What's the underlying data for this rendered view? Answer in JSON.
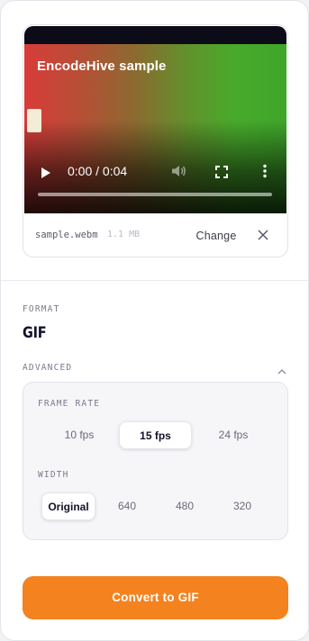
{
  "preview": {
    "title": "EncodeHive sample",
    "time": "0:00 / 0:04",
    "progress_fraction": 0,
    "controls": [
      "play-icon",
      "volume-icon",
      "fullscreen-icon",
      "more-icon"
    ]
  },
  "file": {
    "name": "sample.webm",
    "size": "1.1 MB",
    "change_label": "Change",
    "close_icon": "close-icon"
  },
  "format": {
    "label": "FORMAT",
    "value": "GIF"
  },
  "advanced": {
    "label": "ADVANCED",
    "icon": "chevron-up-icon",
    "frame_rate": {
      "label": "FRAME RATE",
      "options": [
        "10 fps",
        "15 fps",
        "24 fps"
      ],
      "selected": "15 fps"
    },
    "width": {
      "label": "WIDTH",
      "options": [
        "Original",
        "640",
        "480",
        "320"
      ],
      "selected": "Original"
    }
  },
  "convert": {
    "label": "Convert to GIF",
    "color": "#f4821f"
  },
  "colors": {
    "accent": "#f4821f",
    "text_dark": "#12122a",
    "panel_bg": "#f6f6f9"
  }
}
